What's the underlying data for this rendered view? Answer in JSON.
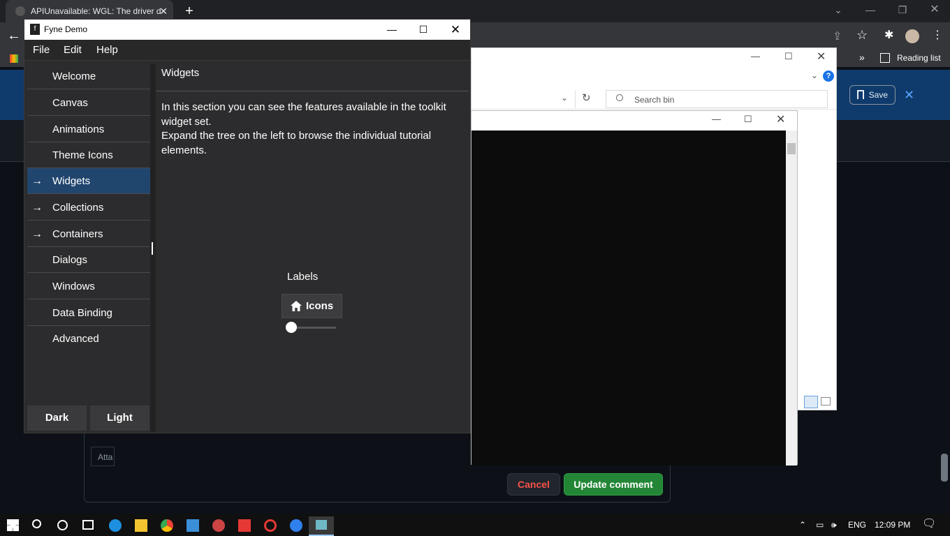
{
  "browser": {
    "tab_title": "APIUnavailable: WGL: The driver d",
    "tab_close": "✕",
    "new_tab": "+",
    "reading_list": "Reading list",
    "more": "»"
  },
  "github": {
    "save_label": "Save",
    "close_glyph": "✕",
    "attach_label": "Atta",
    "cancel_label": "Cancel",
    "update_label": "Update comment"
  },
  "explorer": {
    "search_placeholder": "Search bin",
    "help": "?"
  },
  "fyne": {
    "title": "Fyne Demo",
    "logo": "f",
    "menus": [
      "File",
      "Edit",
      "Help"
    ],
    "nav_items": [
      {
        "label": "Welcome",
        "arrow": ""
      },
      {
        "label": "Canvas",
        "arrow": ""
      },
      {
        "label": "Animations",
        "arrow": ""
      },
      {
        "label": "Theme Icons",
        "arrow": ""
      },
      {
        "label": "Widgets",
        "arrow": "→",
        "selected": true
      },
      {
        "label": "Collections",
        "arrow": "→"
      },
      {
        "label": "Containers",
        "arrow": "→"
      },
      {
        "label": "Dialogs",
        "arrow": ""
      },
      {
        "label": "Windows",
        "arrow": ""
      },
      {
        "label": "Data Binding",
        "arrow": ""
      },
      {
        "label": "Advanced",
        "arrow": ""
      }
    ],
    "theme_dark": "Dark",
    "theme_light": "Light",
    "content_title": "Widgets",
    "content_line1": "In this section you can see the features available in the toolkit widget set.",
    "content_line2": "Expand the tree on the left to browse the individual tutorial elements.",
    "labels_text": "Labels",
    "icons_button": "Icons",
    "slider_value": 0
  },
  "taskbar": {
    "lang": "ENG",
    "time": "12:09 PM"
  }
}
